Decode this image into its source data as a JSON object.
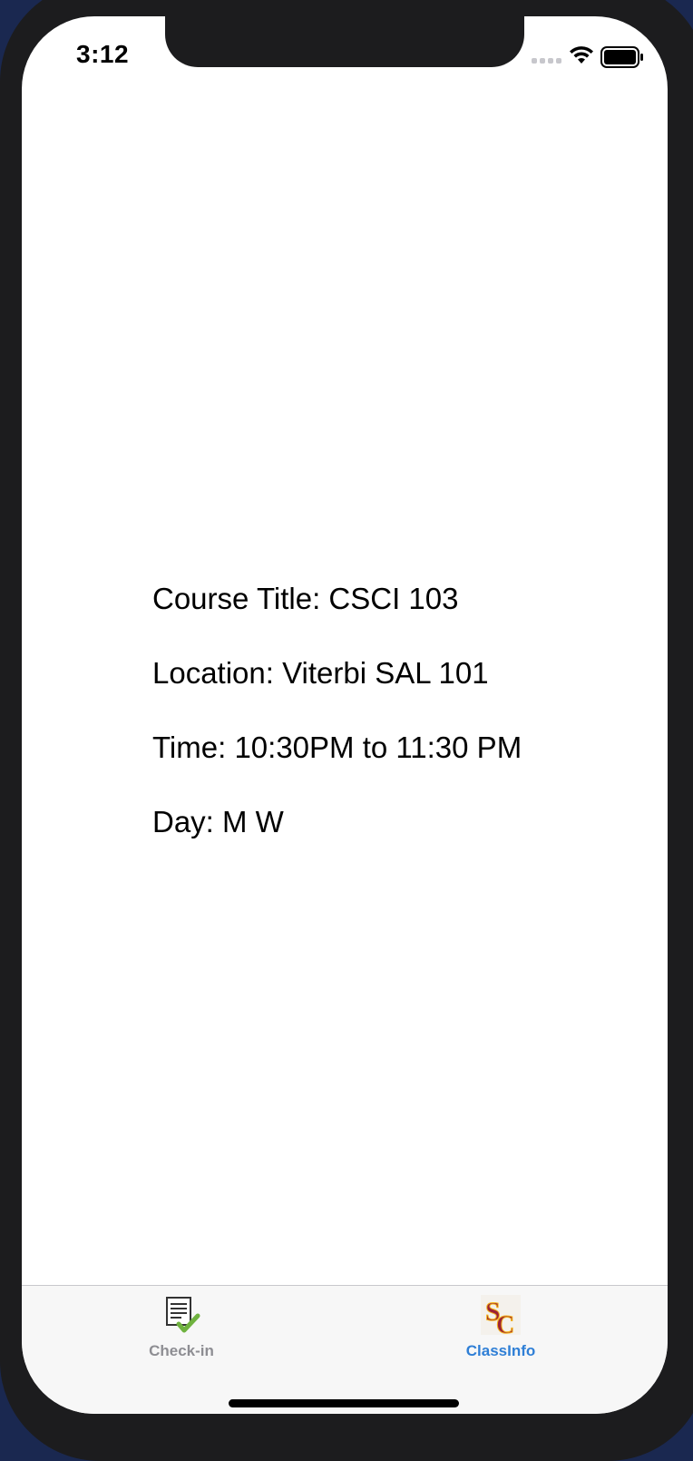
{
  "status_bar": {
    "time": "3:12",
    "icons": [
      "cellular-signal-icon",
      "wifi-icon",
      "battery-icon"
    ]
  },
  "class_info": {
    "course_title": "Course Title: CSCI 103",
    "location": "Location: Viterbi SAL 101",
    "time": "Time: 10:30PM to 11:30 PM",
    "day": "Day: M W"
  },
  "tab_bar": {
    "tabs": [
      {
        "label": "Check-in",
        "icon": "checklist-icon",
        "selected": false
      },
      {
        "label": "ClassInfo",
        "icon": "usc-logo-icon",
        "selected": true
      }
    ]
  },
  "colors": {
    "selected_tab": "#2f7fd6",
    "unselected_tab": "#8e8e93",
    "checkmark": "#6fb23f",
    "usc_cardinal": "#9d2235",
    "usc_gold": "#f2b21b"
  }
}
